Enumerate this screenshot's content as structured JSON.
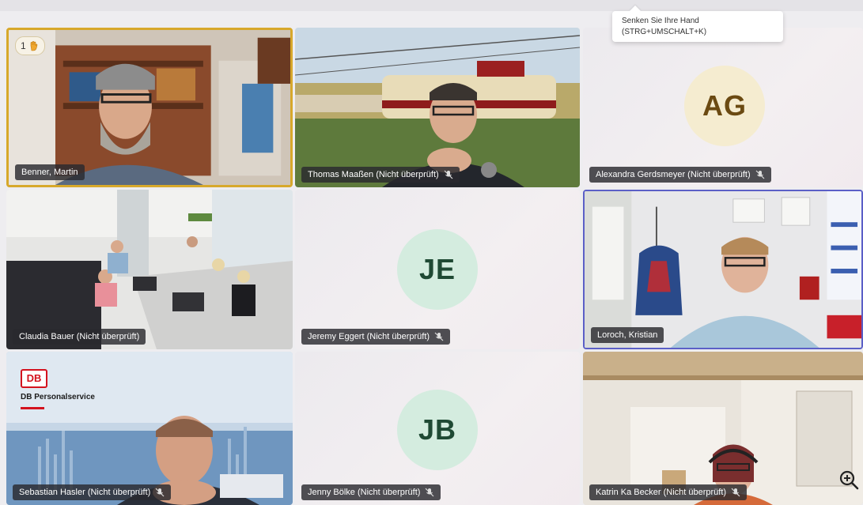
{
  "tooltip": {
    "line1": "Senken Sie Ihre Hand",
    "line2": "(STRG+UMSCHALT+K)"
  },
  "participants": [
    {
      "name": "Benner, Martin",
      "raised_hand_count": "1"
    },
    {
      "name": "Thomas Maaßen (Nicht überprüft)"
    },
    {
      "name": "Alexandra Gerdsmeyer (Nicht überprüft)",
      "initials": "AG",
      "avatar_color": "#f5ecd0",
      "initials_color": "#6b4a12"
    },
    {
      "name": "Claudia Bauer (Nicht überprüft)"
    },
    {
      "name": "Jeremy Eggert (Nicht überprüft)",
      "initials": "JE",
      "avatar_color": "#d4ecdf",
      "initials_color": "#1f4a34"
    },
    {
      "name": "Loroch, Kristian"
    },
    {
      "name": "Sebastian Hasler (Nicht überprüft)",
      "slide_logo": "DB",
      "slide_title": "DB Personalservice"
    },
    {
      "name": "Jenny Bölke (Nicht überprüft)",
      "initials": "JB",
      "avatar_color": "#d4ecdf",
      "initials_color": "#1f4a34"
    },
    {
      "name": "Katrin Ka Becker (Nicht überprüft)"
    }
  ],
  "colors": {
    "raised_hand_border": "#d7a82b",
    "active_speaker_border": "#5b5fc7",
    "name_pill_bg": "#2a2a2e"
  },
  "icons": [
    "hand-icon",
    "mic-off-icon",
    "zoom-in-icon"
  ]
}
